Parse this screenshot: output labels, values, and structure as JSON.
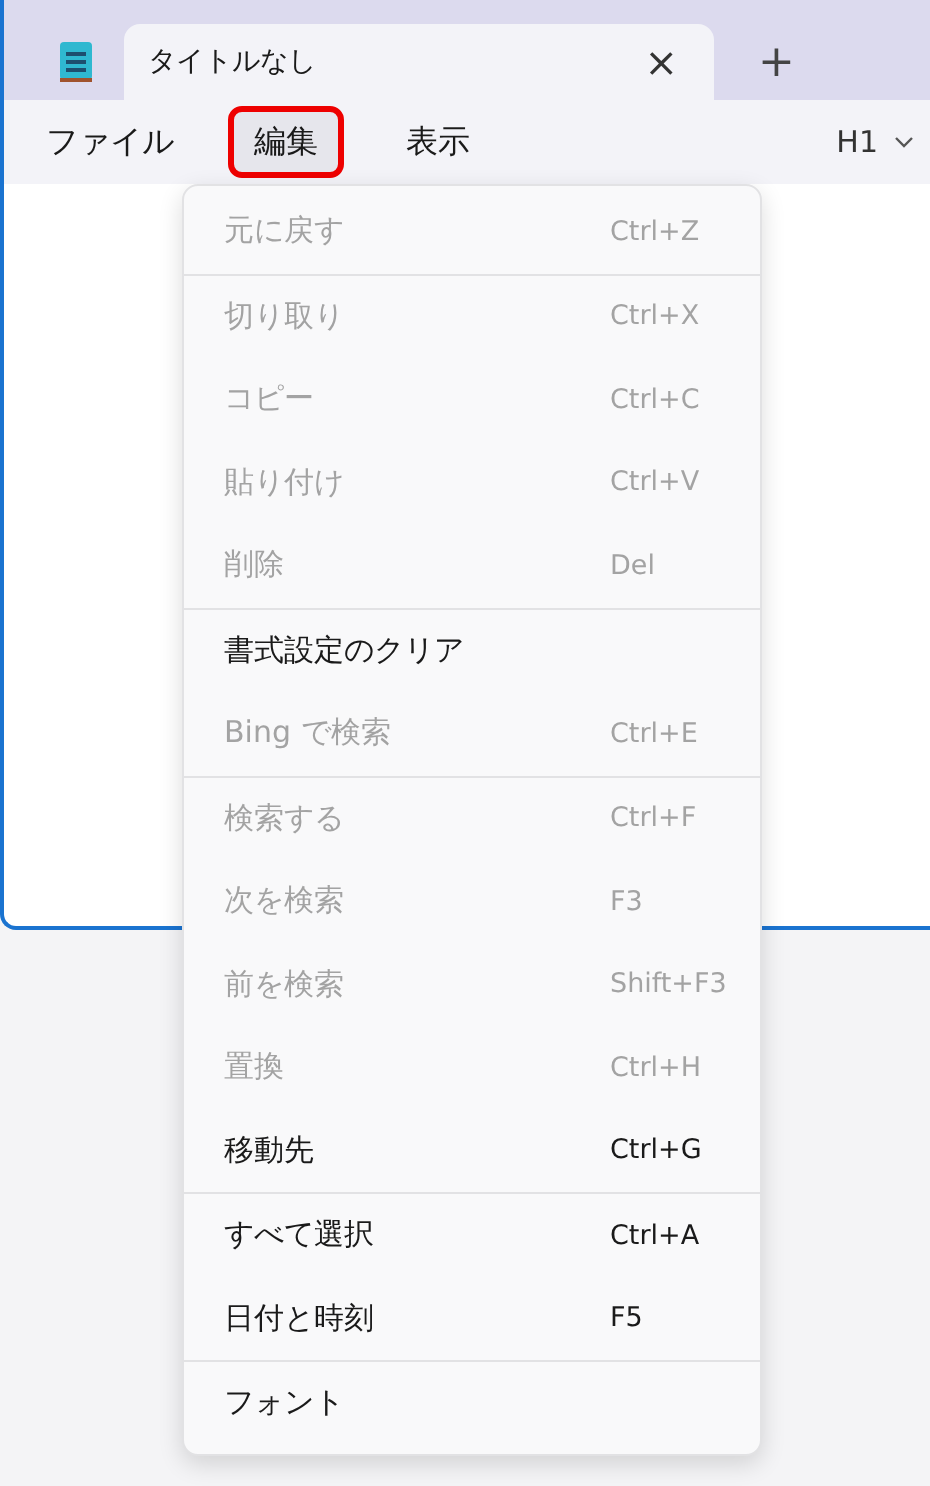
{
  "tabs": [
    {
      "title": "タイトルなし",
      "close": "×",
      "selected": true
    }
  ],
  "new_tab": "+",
  "menubar": {
    "items": [
      {
        "label": "ファイル",
        "highlighted": false
      },
      {
        "label": "編集",
        "highlighted": true
      },
      {
        "label": "表示",
        "highlighted": false
      }
    ],
    "heading_selector": "H1"
  },
  "dropdown": {
    "groups": [
      [
        {
          "label": "元に戻す",
          "shortcut": "Ctrl+Z",
          "disabled": true
        }
      ],
      [
        {
          "label": "切り取り",
          "shortcut": "Ctrl+X",
          "disabled": true
        },
        {
          "label": "コピー",
          "shortcut": "Ctrl+C",
          "disabled": true
        },
        {
          "label": "貼り付け",
          "shortcut": "Ctrl+V",
          "disabled": true
        },
        {
          "label": "削除",
          "shortcut": "Del",
          "disabled": true
        }
      ],
      [
        {
          "label": "書式設定のクリア",
          "disabled": false
        },
        {
          "label": "Bing で検索",
          "shortcut": "Ctrl+E",
          "disabled": true
        }
      ],
      [
        {
          "label": "検索する",
          "shortcut": "Ctrl+F",
          "disabled": true
        },
        {
          "label": "次を検索",
          "shortcut": "F3",
          "disabled": true
        },
        {
          "label": "前を検索",
          "shortcut": "Shift+F3",
          "disabled": true
        },
        {
          "label": "置換",
          "shortcut": "Ctrl+H",
          "disabled": true
        },
        {
          "label": "移動先",
          "shortcut": "Ctrl+G",
          "disabled": false
        }
      ],
      [
        {
          "label": "すべて選択",
          "shortcut": "Ctrl+A",
          "disabled": false
        },
        {
          "label": "日付と時刻",
          "shortcut": "F5",
          "disabled": false
        }
      ],
      [
        {
          "label": "フォント",
          "disabled": false
        }
      ]
    ]
  }
}
